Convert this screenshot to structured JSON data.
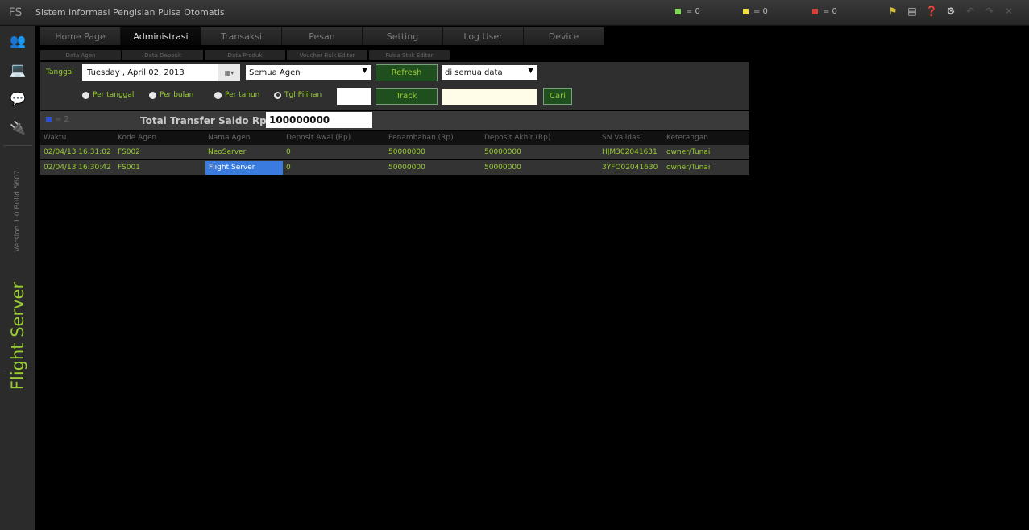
{
  "app": {
    "logo": "FS",
    "title": "Sistem Informasi Pengisian Pulsa Otomatis"
  },
  "status": [
    {
      "value": "= 0",
      "color": "#7ed957"
    },
    {
      "value": "= 0",
      "color": "#f2e23a"
    },
    {
      "value": "= 0",
      "color": "#e03c3c"
    }
  ],
  "title_icons": [
    "flag-icon",
    "document-icon",
    "help-icon",
    "settings-icon",
    "undo-icon",
    "redo-icon",
    "close-icon"
  ],
  "sidebar": {
    "icons": [
      "users-icon",
      "computer-icon",
      "chat-icon",
      "plug-icon"
    ],
    "version": "Version 1.0   Build 5607",
    "name": "Flight Server"
  },
  "nav": {
    "tabs": [
      "Home Page",
      "Administrasi",
      "Transaksi",
      "Pesan",
      "Setting",
      "Log User",
      "Device"
    ],
    "active": "Administrasi"
  },
  "subnav": [
    "Data Agen",
    "Data Deposit",
    "Data Produk",
    "Voucher Fisik Editor",
    "Pulsa Stok Editor"
  ],
  "filter": {
    "tanggal_label": "Tanggal",
    "date_value": "Tuesday ,     April    02, 2013",
    "agen_select": "Semua Agen",
    "refresh_label": "Refresh",
    "scope_select": "di semua data",
    "radios": [
      "Per tanggal",
      "Per bulan",
      "Per tahun",
      "Tgl Pilihan"
    ],
    "selected_radio": "Tgl Pilihan",
    "track_label": "Track",
    "search_value": "",
    "cari_label": "Cari"
  },
  "summary": {
    "count": "= 2",
    "count_color": "#2c4fd8",
    "label": "Total Transfer Saldo Rp.",
    "value": "100000000"
  },
  "table": {
    "columns": [
      "Waktu",
      "Kode Agen",
      "Nama Agen",
      "Deposit Awal (Rp)",
      "Penambahan (Rp)",
      "Deposit Akhir (Rp)",
      "SN Validasi",
      "Keterangan"
    ],
    "rows": [
      [
        "02/04/13 16:31:02",
        "FS002",
        "NeoServer",
        "0",
        "50000000",
        "50000000",
        "HJM302041631",
        "owner/Tunai"
      ],
      [
        "02/04/13 16:30:42",
        "FS001",
        "Flight Server",
        "0",
        "50000000",
        "50000000",
        "3YFO02041630",
        "owner/Tunai"
      ]
    ],
    "selected_row": 1
  }
}
